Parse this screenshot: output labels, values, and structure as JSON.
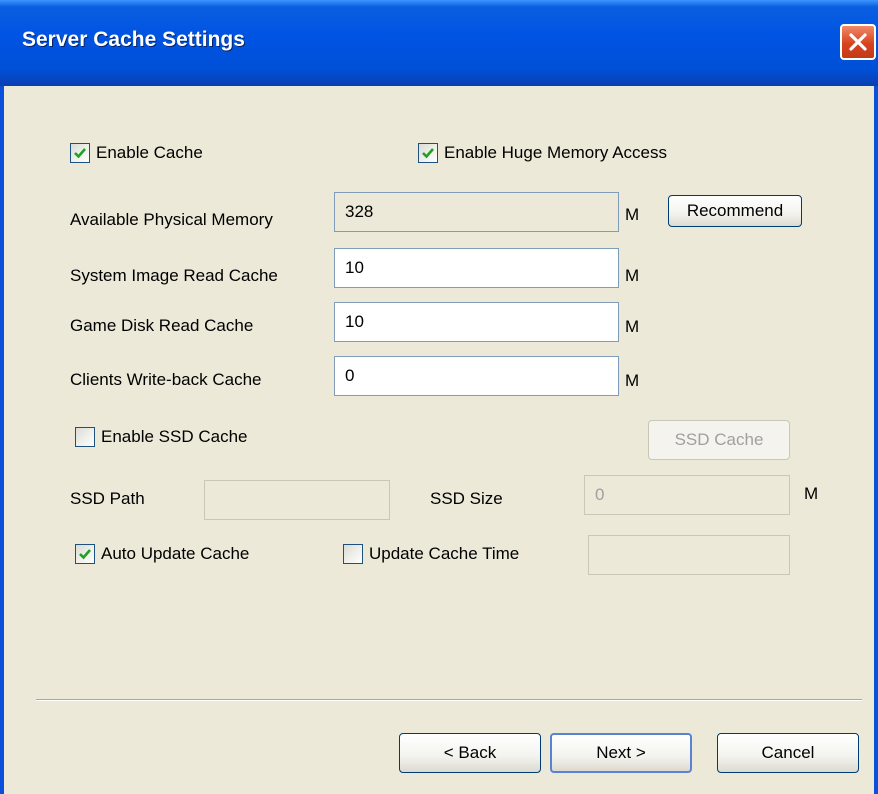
{
  "window": {
    "title": "Server Cache Settings"
  },
  "options": {
    "enable_cache": {
      "label": "Enable Cache",
      "checked": true
    },
    "enable_huge_memory": {
      "label": "Enable Huge Memory Access",
      "checked": true
    }
  },
  "memory": {
    "available_label": "Available Physical Memory",
    "available_value": "328",
    "recommend_label": "Recommend",
    "system_image_label": "System Image Read Cache",
    "system_image_value": "10",
    "game_disk_label": "Game Disk Read Cache",
    "game_disk_value": "10",
    "clients_writeback_label": "Clients Write-back Cache",
    "clients_writeback_value": "0",
    "unit": "M"
  },
  "ssd": {
    "enable_label": "Enable SSD Cache",
    "enabled": false,
    "ssd_cache_button": "SSD Cache",
    "path_label": "SSD Path",
    "path_value": "",
    "size_label": "SSD Size",
    "size_value": "0",
    "unit": "M"
  },
  "update": {
    "auto_label": "Auto Update Cache",
    "auto_checked": true,
    "time_label": "Update Cache Time",
    "time_checked": false,
    "time_value": ""
  },
  "footer": {
    "back": "< Back",
    "next": "Next >",
    "cancel": "Cancel"
  },
  "colors": {
    "titlebar": "#0054e3",
    "dialog_bg": "#ece9d8",
    "checkmark": "#21a121",
    "close_button": "#d8431e"
  }
}
